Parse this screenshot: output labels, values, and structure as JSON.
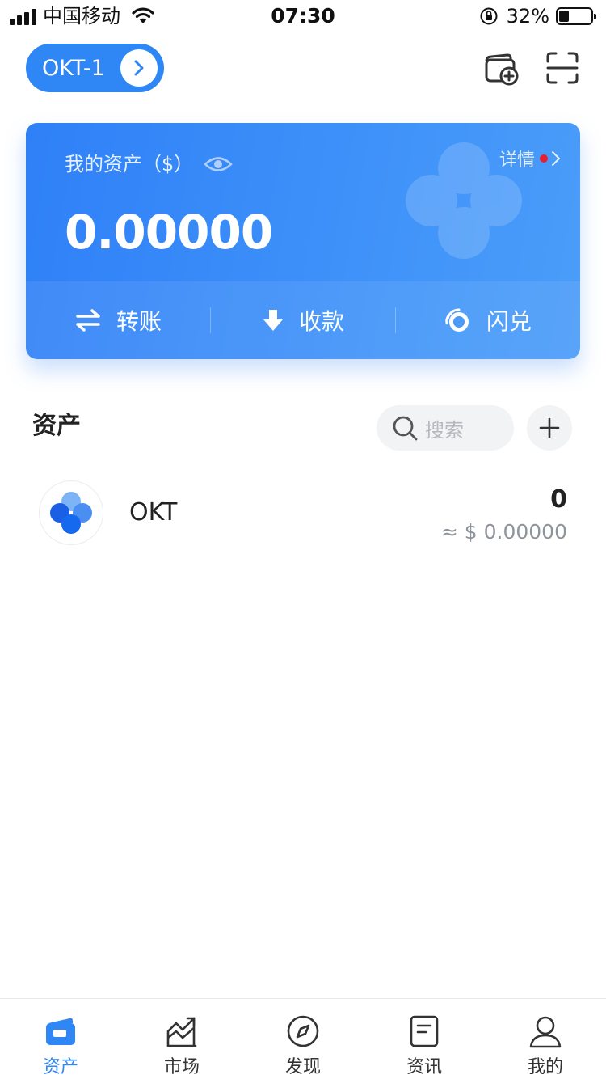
{
  "status_bar": {
    "carrier": "中国移动",
    "time": "07:30",
    "battery_percent": "32%",
    "battery_level": 0.32,
    "icons": [
      "signal-icon",
      "wifi-icon",
      "rotation-lock-icon",
      "battery-icon"
    ]
  },
  "header": {
    "wallet_name": "OKT-1",
    "icons": [
      "chevron-right-icon",
      "add-wallet-icon",
      "scan-icon"
    ]
  },
  "asset_card": {
    "title": "我的资产（$）",
    "details_label": "详情",
    "balance": "0.00000",
    "actions": [
      {
        "label": "转账",
        "icon": "transfer-icon"
      },
      {
        "label": "收款",
        "icon": "receive-icon"
      },
      {
        "label": "闪兑",
        "icon": "swap-icon"
      }
    ]
  },
  "assets_section": {
    "title": "资产",
    "search_placeholder": "搜索",
    "tokens": [
      {
        "name": "OKT",
        "amount": "0",
        "value": "≈ $ 0.00000",
        "icon": "okt-logo-icon"
      }
    ]
  },
  "tab_bar": {
    "tabs": [
      {
        "label": "资产",
        "icon": "wallet-icon",
        "active": true
      },
      {
        "label": "市场",
        "icon": "market-icon",
        "active": false
      },
      {
        "label": "发现",
        "icon": "compass-icon",
        "active": false
      },
      {
        "label": "资讯",
        "icon": "news-icon",
        "active": false
      },
      {
        "label": "我的",
        "icon": "profile-icon",
        "active": false
      }
    ]
  },
  "colors": {
    "accent": "#2f87f6",
    "card_gradient_start": "#2f80f7",
    "card_gradient_end": "#4b9df9",
    "notification_dot": "#e8202e"
  }
}
